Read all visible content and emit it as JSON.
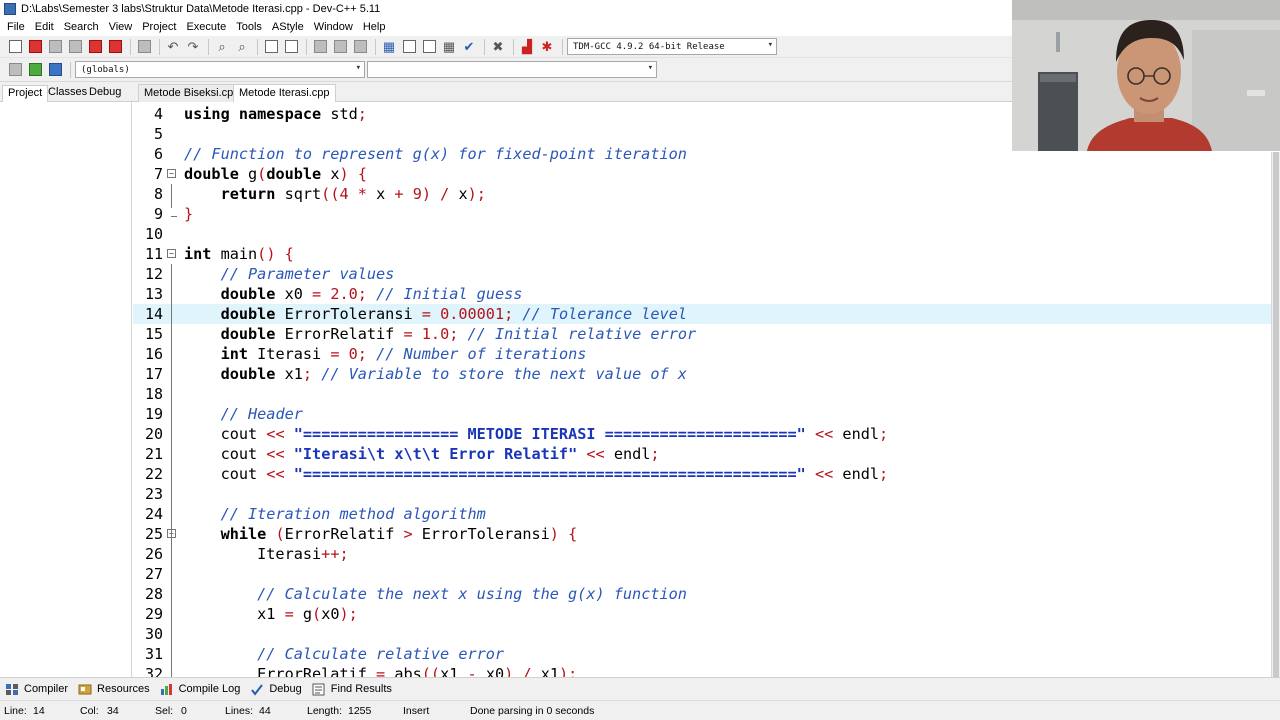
{
  "window": {
    "title": "D:\\Labs\\Semester 3 labs\\Struktur Data\\Metode Iterasi.cpp - Dev-C++ 5.11"
  },
  "menu": [
    "File",
    "Edit",
    "Search",
    "View",
    "Project",
    "Execute",
    "Tools",
    "AStyle",
    "Window",
    "Help"
  ],
  "toolbar": {
    "compiler_select": "TDM-GCC 4.9.2 64-bit Release",
    "scope_select": "(globals)",
    "function_select": ""
  },
  "panel_tabs": [
    "Project",
    "Classes",
    "Debug"
  ],
  "file_tabs": [
    "Metode Biseksi.cpp",
    "Metode Iterasi.cpp"
  ],
  "editor": {
    "current_line": 14,
    "lines": [
      {
        "n": "4",
        "code": "using namespace std;"
      },
      {
        "n": "5",
        "code": ""
      },
      {
        "n": "6",
        "code": "// Function to represent g(x) for fixed-point iteration"
      },
      {
        "n": "7",
        "code": "double g(double x) {"
      },
      {
        "n": "8",
        "code": "    return sqrt((4 * x + 9) / x);"
      },
      {
        "n": "9",
        "code": "}"
      },
      {
        "n": "10",
        "code": ""
      },
      {
        "n": "11",
        "code": "int main() {"
      },
      {
        "n": "12",
        "code": "    // Parameter values"
      },
      {
        "n": "13",
        "code": "    double x0 = 2.0; // Initial guess"
      },
      {
        "n": "14",
        "code": "    double ErrorToleransi = 0.00001; // Tolerance level"
      },
      {
        "n": "15",
        "code": "    double ErrorRelatif = 1.0; // Initial relative error"
      },
      {
        "n": "16",
        "code": "    int Iterasi = 0; // Number of iterations"
      },
      {
        "n": "17",
        "code": "    double x1; // Variable to store the next value of x"
      },
      {
        "n": "18",
        "code": ""
      },
      {
        "n": "19",
        "code": "    // Header"
      },
      {
        "n": "20",
        "code": "    cout << \"================= METODE ITERASI =====================\" << endl;"
      },
      {
        "n": "21",
        "code": "    cout << \"Iterasi\\t x\\t\\t Error Relatif\" << endl;"
      },
      {
        "n": "22",
        "code": "    cout << \"======================================================\" << endl;"
      },
      {
        "n": "23",
        "code": ""
      },
      {
        "n": "24",
        "code": "    // Iteration method algorithm"
      },
      {
        "n": "25",
        "code": "    while (ErrorRelatif > ErrorToleransi) {"
      },
      {
        "n": "26",
        "code": "        Iterasi++;"
      },
      {
        "n": "27",
        "code": ""
      },
      {
        "n": "28",
        "code": "        // Calculate the next x using the g(x) function"
      },
      {
        "n": "29",
        "code": "        x1 = g(x0);"
      },
      {
        "n": "30",
        "code": ""
      },
      {
        "n": "31",
        "code": "        // Calculate relative error"
      },
      {
        "n": "32",
        "code": "        ErrorRelatif = abs((x1 - x0) / x1);"
      }
    ]
  },
  "bottom_tabs": [
    {
      "label": "Compiler",
      "icon": "compiler-icon"
    },
    {
      "label": "Resources",
      "icon": "resources-icon"
    },
    {
      "label": "Compile Log",
      "icon": "compile-log-icon"
    },
    {
      "label": "Debug",
      "icon": "debug-icon"
    },
    {
      "label": "Find Results",
      "icon": "find-results-icon"
    }
  ],
  "status": {
    "line_label": "Line:",
    "line_value": "14",
    "col_label": "Col:",
    "col_value": "34",
    "sel_label": "Sel:",
    "sel_value": "0",
    "lines_label": "Lines:",
    "lines_value": "44",
    "length_label": "Length:",
    "length_value": "1255",
    "mode": "Insert",
    "message": "Done parsing in 0 seconds"
  },
  "colors": {
    "keyword": "#000000",
    "comment": "#2a57b8",
    "operator": "#b5121b",
    "string": "#1a35b8",
    "current_line_bg": "#e0f4fb"
  }
}
